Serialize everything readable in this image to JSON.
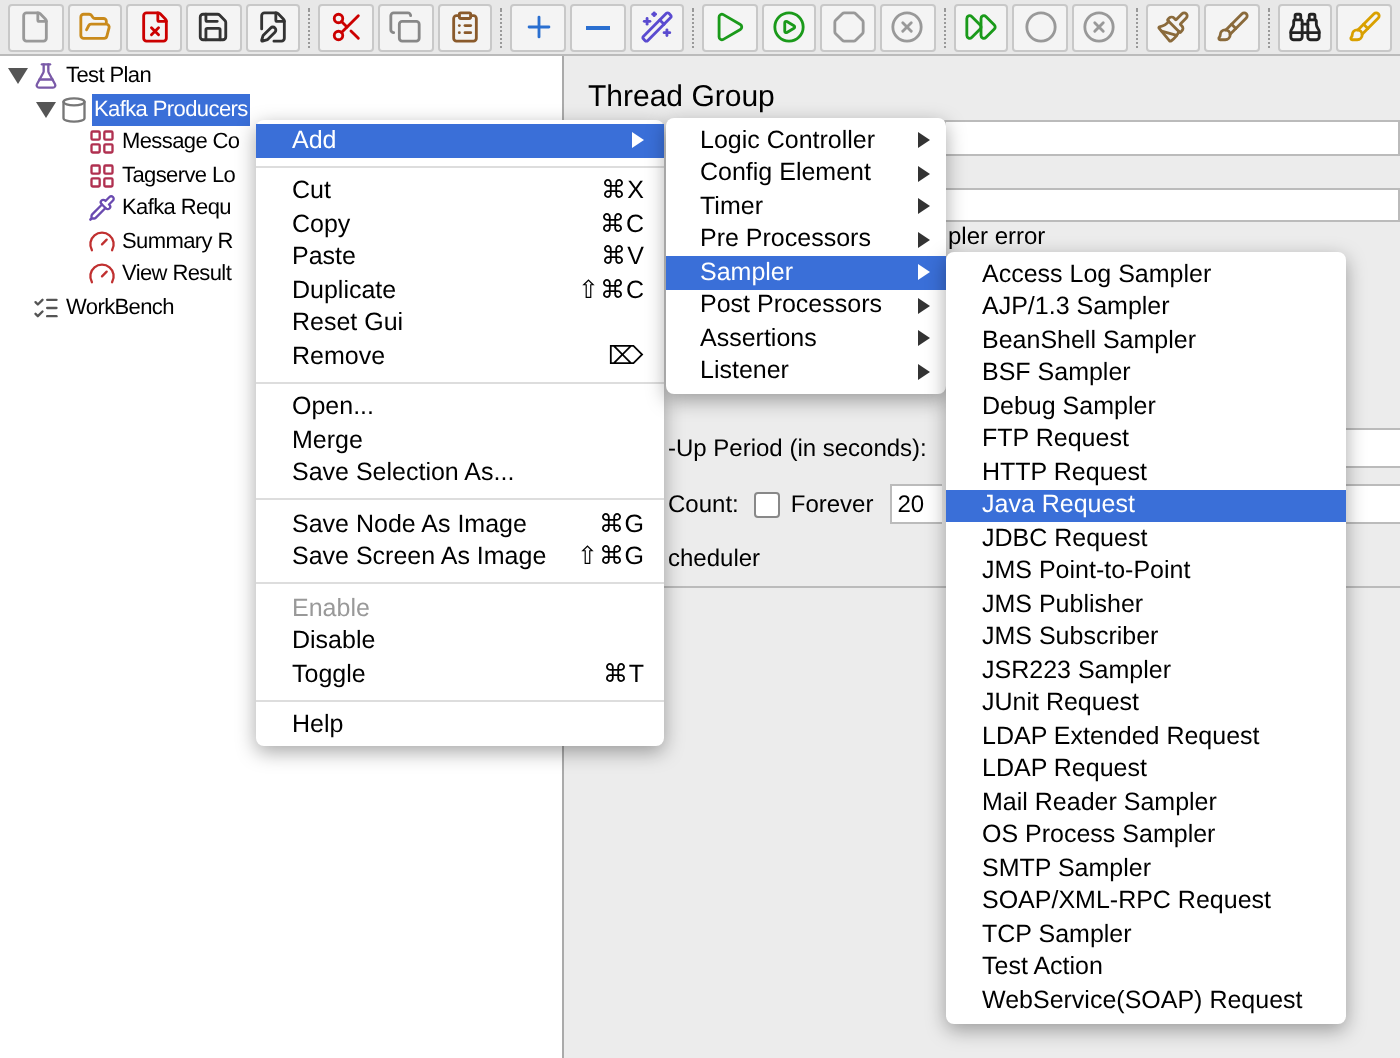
{
  "tree": [
    {
      "kind": "plan",
      "label": "Test Plan",
      "selected": false,
      "expanded": true,
      "children": [
        {
          "kind": "group",
          "label": "Kafka Producers",
          "selected": true,
          "expanded": true,
          "children": [
            {
              "kind": "generator",
              "label": "Message Co",
              "selected": false
            },
            {
              "kind": "generator",
              "label": "Tagserve Lo",
              "selected": false
            },
            {
              "kind": "sampler",
              "label": "Kafka Requ",
              "selected": false
            },
            {
              "kind": "listener",
              "label": "Summary R",
              "selected": false
            },
            {
              "kind": "listener",
              "label": "View Result",
              "selected": false
            }
          ]
        }
      ]
    },
    {
      "kind": "workbench",
      "label": "WorkBench",
      "selected": false
    }
  ],
  "panel": {
    "title": "Thread Group",
    "error_label": "pler error",
    "ramp_label": "-Up Period (in seconds):",
    "loop_label": "Count:",
    "forever": {
      "label": "Forever",
      "checked": false
    },
    "loop_value": "20",
    "scheduler_label": "cheduler"
  },
  "context_menu": [
    {
      "kind": "item",
      "label": "Add",
      "submenu": true,
      "selected": true,
      "disabled": false
    },
    {
      "kind": "separator"
    },
    {
      "kind": "item",
      "label": "Cut",
      "shortcut": "⌘X",
      "selected": false,
      "disabled": false
    },
    {
      "kind": "item",
      "label": "Copy",
      "shortcut": "⌘C",
      "selected": false,
      "disabled": false
    },
    {
      "kind": "item",
      "label": "Paste",
      "shortcut": "⌘V",
      "selected": false,
      "disabled": false
    },
    {
      "kind": "item",
      "label": "Duplicate",
      "shortcut": "⇧⌘C",
      "selected": false,
      "disabled": false
    },
    {
      "kind": "item",
      "label": "Reset Gui",
      "selected": false,
      "disabled": false
    },
    {
      "kind": "item",
      "label": "Remove",
      "shortcut": "⌦",
      "selected": false,
      "disabled": false
    },
    {
      "kind": "separator"
    },
    {
      "kind": "item",
      "label": "Open...",
      "selected": false,
      "disabled": false
    },
    {
      "kind": "item",
      "label": "Merge",
      "selected": false,
      "disabled": false
    },
    {
      "kind": "item",
      "label": "Save Selection As...",
      "selected": false,
      "disabled": false
    },
    {
      "kind": "separator"
    },
    {
      "kind": "item",
      "label": "Save Node As Image",
      "shortcut": "⌘G",
      "selected": false,
      "disabled": false
    },
    {
      "kind": "item",
      "label": "Save Screen As Image",
      "shortcut": "⇧⌘G",
      "selected": false,
      "disabled": false
    },
    {
      "kind": "separator"
    },
    {
      "kind": "item",
      "label": "Enable",
      "selected": false,
      "disabled": true
    },
    {
      "kind": "item",
      "label": "Disable",
      "selected": false,
      "disabled": false
    },
    {
      "kind": "item",
      "label": "Toggle",
      "shortcut": "⌘T",
      "selected": false,
      "disabled": false
    },
    {
      "kind": "separator"
    },
    {
      "kind": "item",
      "label": "Help",
      "selected": false,
      "disabled": false
    }
  ],
  "add_menu": [
    {
      "label": "Logic Controller",
      "selected": false
    },
    {
      "label": "Config Element",
      "selected": false
    },
    {
      "label": "Timer",
      "selected": false
    },
    {
      "label": "Pre Processors",
      "selected": false
    },
    {
      "label": "Sampler",
      "selected": true
    },
    {
      "label": "Post Processors",
      "selected": false
    },
    {
      "label": "Assertions",
      "selected": false
    },
    {
      "label": "Listener",
      "selected": false
    }
  ],
  "sampler_menu": [
    {
      "label": "Access Log Sampler",
      "selected": false
    },
    {
      "label": "AJP/1.3 Sampler",
      "selected": false
    },
    {
      "label": "BeanShell Sampler",
      "selected": false
    },
    {
      "label": "BSF Sampler",
      "selected": false
    },
    {
      "label": "Debug Sampler",
      "selected": false
    },
    {
      "label": "FTP Request",
      "selected": false
    },
    {
      "label": "HTTP Request",
      "selected": false
    },
    {
      "label": "Java Request",
      "selected": true
    },
    {
      "label": "JDBC Request",
      "selected": false
    },
    {
      "label": "JMS Point-to-Point",
      "selected": false
    },
    {
      "label": "JMS Publisher",
      "selected": false
    },
    {
      "label": "JMS Subscriber",
      "selected": false
    },
    {
      "label": "JSR223 Sampler",
      "selected": false
    },
    {
      "label": "JUnit Request",
      "selected": false
    },
    {
      "label": "LDAP Extended Request",
      "selected": false
    },
    {
      "label": "LDAP Request",
      "selected": false
    },
    {
      "label": "Mail Reader Sampler",
      "selected": false
    },
    {
      "label": "OS Process Sampler",
      "selected": false
    },
    {
      "label": "SMTP Sampler",
      "selected": false
    },
    {
      "label": "SOAP/XML-RPC Request",
      "selected": false
    },
    {
      "label": "TCP Sampler",
      "selected": false
    },
    {
      "label": "Test Action",
      "selected": false
    },
    {
      "label": "WebService(SOAP) Request",
      "selected": false
    }
  ]
}
